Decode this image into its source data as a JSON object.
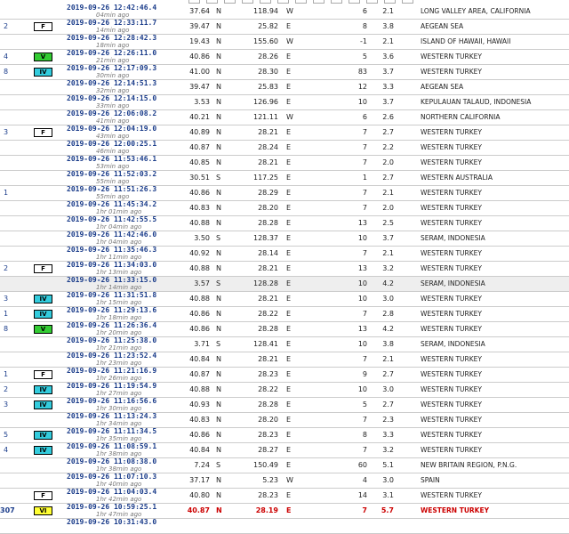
{
  "colors": {
    "intensity_F": "#ffffff",
    "intensity_II": "#ffffff",
    "intensity_IV": "#33ccdd",
    "intensity_V": "#33cc33",
    "intensity_VI": "#ffff33",
    "date_text": "#1a3c8a",
    "highlight_text": "#cc0000"
  },
  "rows": [
    {
      "felt": "",
      "int": "",
      "date": "2019-09-26  12:42:46.4",
      "ago": "04min ago",
      "lat": "37.64",
      "ns": "N",
      "lon": "118.94",
      "ew": "W",
      "depth": "6",
      "mag": "2.1",
      "region": "LONG VALLEY AREA, CALIFORNIA"
    },
    {
      "felt": "2",
      "int": "F",
      "date": "2019-09-26  12:33:11.7",
      "ago": "14min ago",
      "lat": "39.47",
      "ns": "N",
      "lon": "25.82",
      "ew": "E",
      "depth": "8",
      "mag": "3.8",
      "region": "AEGEAN SEA"
    },
    {
      "felt": "",
      "int": "",
      "date": "2019-09-26  12:28:42.3",
      "ago": "18min ago",
      "lat": "19.43",
      "ns": "N",
      "lon": "155.60",
      "ew": "W",
      "depth": "-1",
      "mag": "2.1",
      "region": "ISLAND OF HAWAII, HAWAII"
    },
    {
      "felt": "4",
      "int": "V",
      "date": "2019-09-26  12:26:11.0",
      "ago": "21min ago",
      "lat": "40.86",
      "ns": "N",
      "lon": "28.26",
      "ew": "E",
      "depth": "5",
      "mag": "3.6",
      "region": "WESTERN TURKEY"
    },
    {
      "felt": "8",
      "int": "IV",
      "date": "2019-09-26  12:17:09.3",
      "ago": "30min ago",
      "lat": "41.00",
      "ns": "N",
      "lon": "28.30",
      "ew": "E",
      "depth": "83",
      "mag": "3.7",
      "region": "WESTERN TURKEY"
    },
    {
      "felt": "",
      "int": "",
      "date": "2019-09-26  12:14:51.3",
      "ago": "32min ago",
      "lat": "39.47",
      "ns": "N",
      "lon": "25.83",
      "ew": "E",
      "depth": "12",
      "mag": "3.3",
      "region": "AEGEAN SEA"
    },
    {
      "felt": "",
      "int": "",
      "date": "2019-09-26  12:14:15.0",
      "ago": "33min ago",
      "lat": "3.53",
      "ns": "N",
      "lon": "126.96",
      "ew": "E",
      "depth": "10",
      "mag": "3.7",
      "region": "KEPULAUAN TALAUD, INDONESIA"
    },
    {
      "felt": "",
      "int": "",
      "date": "2019-09-26  12:06:08.2",
      "ago": "41min ago",
      "lat": "40.21",
      "ns": "N",
      "lon": "121.11",
      "ew": "W",
      "depth": "6",
      "mag": "2.6",
      "region": "NORTHERN CALIFORNIA"
    },
    {
      "felt": "3",
      "int": "F",
      "date": "2019-09-26  12:04:19.0",
      "ago": "43min ago",
      "lat": "40.89",
      "ns": "N",
      "lon": "28.21",
      "ew": "E",
      "depth": "7",
      "mag": "2.7",
      "region": "WESTERN TURKEY"
    },
    {
      "felt": "",
      "int": "",
      "date": "2019-09-26  12:00:25.1",
      "ago": "46min ago",
      "lat": "40.87",
      "ns": "N",
      "lon": "28.24",
      "ew": "E",
      "depth": "7",
      "mag": "2.2",
      "region": "WESTERN TURKEY"
    },
    {
      "felt": "",
      "int": "",
      "date": "2019-09-26  11:53:46.1",
      "ago": "53min ago",
      "lat": "40.85",
      "ns": "N",
      "lon": "28.21",
      "ew": "E",
      "depth": "7",
      "mag": "2.0",
      "region": "WESTERN TURKEY"
    },
    {
      "felt": "",
      "int": "",
      "date": "2019-09-26  11:52:03.2",
      "ago": "55min ago",
      "lat": "30.51",
      "ns": "S",
      "lon": "117.25",
      "ew": "E",
      "depth": "1",
      "mag": "2.7",
      "region": "WESTERN AUSTRALIA"
    },
    {
      "felt": "1",
      "int": "",
      "date": "2019-09-26  11:51:26.3",
      "ago": "55min ago",
      "lat": "40.86",
      "ns": "N",
      "lon": "28.29",
      "ew": "E",
      "depth": "7",
      "mag": "2.1",
      "region": "WESTERN TURKEY"
    },
    {
      "felt": "",
      "int": "",
      "date": "2019-09-26  11:45:34.2",
      "ago": "1hr 01min ago",
      "lat": "40.83",
      "ns": "N",
      "lon": "28.20",
      "ew": "E",
      "depth": "7",
      "mag": "2.0",
      "region": "WESTERN TURKEY"
    },
    {
      "felt": "",
      "int": "",
      "date": "2019-09-26  11:42:55.5",
      "ago": "1hr 04min ago",
      "lat": "40.88",
      "ns": "N",
      "lon": "28.28",
      "ew": "E",
      "depth": "13",
      "mag": "2.5",
      "region": "WESTERN TURKEY"
    },
    {
      "felt": "",
      "int": "",
      "date": "2019-09-26  11:42:46.0",
      "ago": "1hr 04min ago",
      "lat": "3.50",
      "ns": "S",
      "lon": "128.37",
      "ew": "E",
      "depth": "10",
      "mag": "3.7",
      "region": "SERAM, INDONESIA"
    },
    {
      "felt": "",
      "int": "",
      "date": "2019-09-26  11:35:46.3",
      "ago": "1hr 11min ago",
      "lat": "40.92",
      "ns": "N",
      "lon": "28.14",
      "ew": "E",
      "depth": "7",
      "mag": "2.1",
      "region": "WESTERN TURKEY"
    },
    {
      "felt": "2",
      "int": "F",
      "date": "2019-09-26  11:34:03.0",
      "ago": "1hr 13min ago",
      "lat": "40.88",
      "ns": "N",
      "lon": "28.21",
      "ew": "E",
      "depth": "13",
      "mag": "3.2",
      "region": "WESTERN TURKEY"
    },
    {
      "felt": "",
      "int": "",
      "date": "2019-09-26  11:33:15.0",
      "ago": "1hr 14min ago",
      "lat": "3.57",
      "ns": "S",
      "lon": "128.28",
      "ew": "E",
      "depth": "10",
      "mag": "4.2",
      "region": "SERAM, INDONESIA",
      "alt": true
    },
    {
      "felt": "3",
      "int": "IV",
      "date": "2019-09-26  11:31:51.8",
      "ago": "1hr 15min ago",
      "lat": "40.88",
      "ns": "N",
      "lon": "28.21",
      "ew": "E",
      "depth": "10",
      "mag": "3.0",
      "region": "WESTERN TURKEY"
    },
    {
      "felt": "1",
      "int": "IV",
      "date": "2019-09-26  11:29:13.6",
      "ago": "1hr 18min ago",
      "lat": "40.86",
      "ns": "N",
      "lon": "28.22",
      "ew": "E",
      "depth": "7",
      "mag": "2.8",
      "region": "WESTERN TURKEY"
    },
    {
      "felt": "8",
      "int": "V",
      "date": "2019-09-26  11:26:36.4",
      "ago": "1hr 20min ago",
      "lat": "40.86",
      "ns": "N",
      "lon": "28.28",
      "ew": "E",
      "depth": "13",
      "mag": "4.2",
      "region": "WESTERN TURKEY"
    },
    {
      "felt": "",
      "int": "",
      "date": "2019-09-26  11:25:38.0",
      "ago": "1hr 21min ago",
      "lat": "3.71",
      "ns": "S",
      "lon": "128.41",
      "ew": "E",
      "depth": "10",
      "mag": "3.8",
      "region": "SERAM, INDONESIA"
    },
    {
      "felt": "",
      "int": "",
      "date": "2019-09-26  11:23:52.4",
      "ago": "1hr 23min ago",
      "lat": "40.84",
      "ns": "N",
      "lon": "28.21",
      "ew": "E",
      "depth": "7",
      "mag": "2.1",
      "region": "WESTERN TURKEY"
    },
    {
      "felt": "1",
      "int": "F",
      "date": "2019-09-26  11:21:16.9",
      "ago": "1hr 26min ago",
      "lat": "40.87",
      "ns": "N",
      "lon": "28.23",
      "ew": "E",
      "depth": "9",
      "mag": "2.7",
      "region": "WESTERN TURKEY"
    },
    {
      "felt": "2",
      "int": "IV",
      "date": "2019-09-26  11:19:54.9",
      "ago": "1hr 27min ago",
      "lat": "40.88",
      "ns": "N",
      "lon": "28.22",
      "ew": "E",
      "depth": "10",
      "mag": "3.0",
      "region": "WESTERN TURKEY"
    },
    {
      "felt": "3",
      "int": "IV",
      "date": "2019-09-26  11:16:56.6",
      "ago": "1hr 30min ago",
      "lat": "40.93",
      "ns": "N",
      "lon": "28.28",
      "ew": "E",
      "depth": "5",
      "mag": "2.7",
      "region": "WESTERN TURKEY"
    },
    {
      "felt": "",
      "int": "",
      "date": "2019-09-26  11:13:24.3",
      "ago": "1hr 34min ago",
      "lat": "40.83",
      "ns": "N",
      "lon": "28.20",
      "ew": "E",
      "depth": "7",
      "mag": "2.3",
      "region": "WESTERN TURKEY"
    },
    {
      "felt": "5",
      "int": "IV",
      "date": "2019-09-26  11:11:34.5",
      "ago": "1hr 35min ago",
      "lat": "40.86",
      "ns": "N",
      "lon": "28.23",
      "ew": "E",
      "depth": "8",
      "mag": "3.3",
      "region": "WESTERN TURKEY"
    },
    {
      "felt": "4",
      "int": "IV",
      "date": "2019-09-26  11:08:59.1",
      "ago": "1hr 38min ago",
      "lat": "40.84",
      "ns": "N",
      "lon": "28.27",
      "ew": "E",
      "depth": "7",
      "mag": "3.2",
      "region": "WESTERN TURKEY"
    },
    {
      "felt": "",
      "int": "",
      "date": "2019-09-26  11:08:38.0",
      "ago": "1hr 38min ago",
      "lat": "7.24",
      "ns": "S",
      "lon": "150.49",
      "ew": "E",
      "depth": "60",
      "mag": "5.1",
      "region": "NEW BRITAIN REGION, P.N.G."
    },
    {
      "felt": "",
      "int": "",
      "date": "2019-09-26  11:07:10.3",
      "ago": "1hr 40min ago",
      "lat": "37.17",
      "ns": "N",
      "lon": "5.23",
      "ew": "W",
      "depth": "4",
      "mag": "3.0",
      "region": "SPAIN"
    },
    {
      "felt": "",
      "int": "F",
      "date": "2019-09-26  11:04:03.4",
      "ago": "1hr 42min ago",
      "lat": "40.80",
      "ns": "N",
      "lon": "28.23",
      "ew": "E",
      "depth": "14",
      "mag": "3.1",
      "region": "WESTERN TURKEY"
    },
    {
      "felt": "307",
      "int": "VI",
      "date": "2019-09-26  10:59:25.1",
      "ago": "1hr 47min ago",
      "lat": "40.87",
      "ns": "N",
      "lon": "28.19",
      "ew": "E",
      "depth": "7",
      "mag": "5.7",
      "region": "WESTERN TURKEY",
      "highlight": true
    },
    {
      "felt": "",
      "int": "",
      "date": "2019-09-26  10:31:43.0",
      "ago": "",
      "lat": "",
      "ns": "",
      "lon": "",
      "ew": "",
      "depth": "",
      "mag": "",
      "region": ""
    }
  ]
}
